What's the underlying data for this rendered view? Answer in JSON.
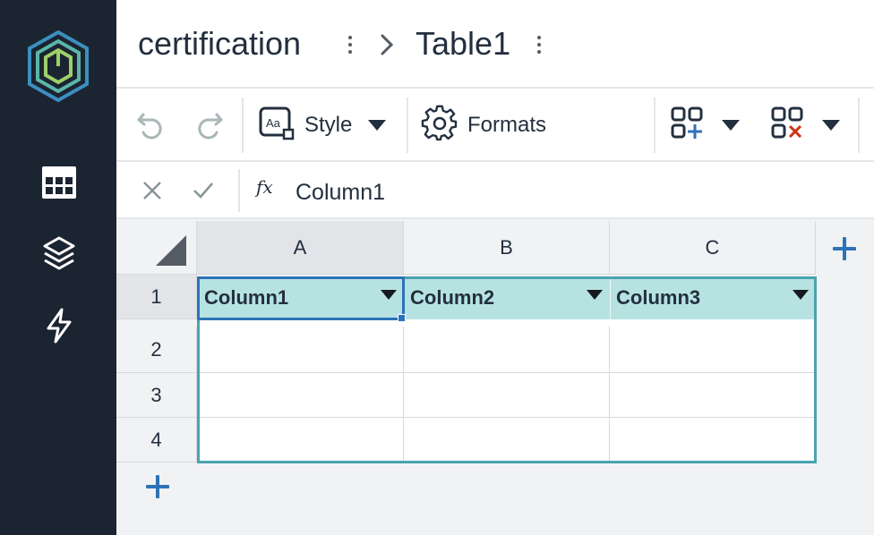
{
  "breadcrumb": {
    "parent": "certification",
    "current": "Table1"
  },
  "sidebar": {
    "items": [
      {
        "icon": "table-grid-icon"
      },
      {
        "icon": "layers-icon"
      },
      {
        "icon": "lightning-icon"
      }
    ]
  },
  "toolbar": {
    "undo_icon": "undo-icon",
    "redo_icon": "redo-icon",
    "style_label": "Style",
    "formats_label": "Formats",
    "insert_icon": "insert-cells-icon",
    "delete_icon": "delete-cells-icon"
  },
  "formula_bar": {
    "fx_label": "fx",
    "value": "Column1"
  },
  "grid": {
    "column_headers": [
      "A",
      "B",
      "C"
    ],
    "row_headers": [
      "1",
      "2",
      "3",
      "4"
    ],
    "table_header_cells": [
      "Column1",
      "Column2",
      "Column3"
    ],
    "selected_cell": "A1"
  },
  "colors": {
    "sidebar_bg": "#1b2431",
    "table_header_bg": "#b6e3e2",
    "table_border": "#4aa3b0",
    "selection": "#2e73b8",
    "accent_plus": "#2e73b8"
  }
}
